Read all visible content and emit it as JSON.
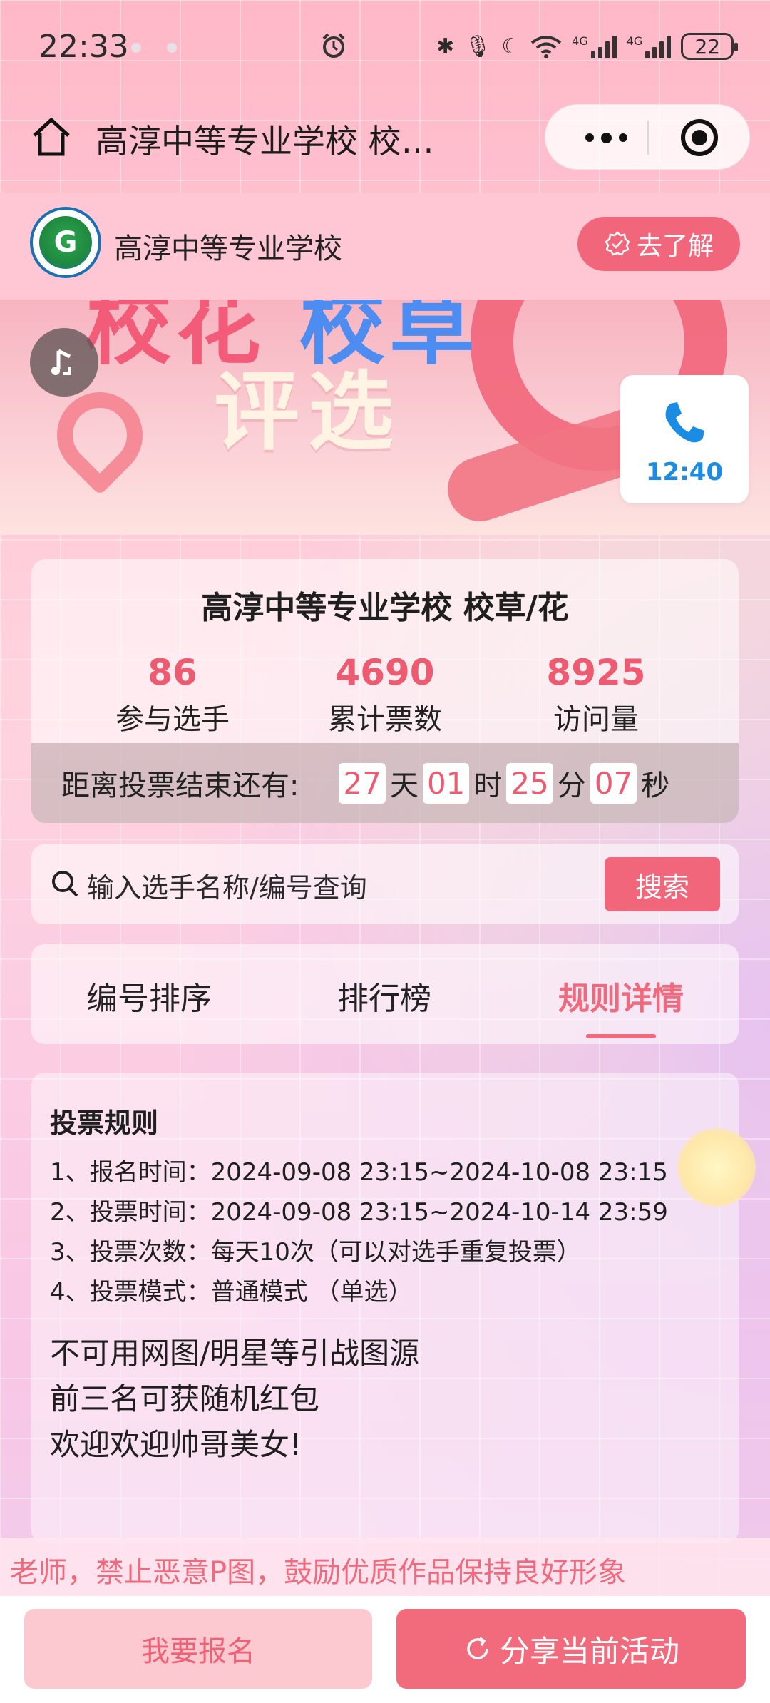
{
  "status_bar": {
    "time": "22:33",
    "battery": "22",
    "network": "4G"
  },
  "nav": {
    "title": "高淳中等专业学校 校…"
  },
  "header": {
    "school_name": "高淳中等专业学校",
    "learn_more": "去了解",
    "logo_letter": "G"
  },
  "banner": {
    "title_cut_left": "校花",
    "title_cut_right": "校草",
    "title": "评选"
  },
  "call_widget": {
    "time": "12:40"
  },
  "stats": {
    "title": "高淳中等专业学校 校草/花",
    "items": [
      {
        "value": "86",
        "label": "参与选手"
      },
      {
        "value": "4690",
        "label": "累计票数"
      },
      {
        "value": "8925",
        "label": "访问量"
      }
    ]
  },
  "countdown": {
    "label": "距离投票结束还有:",
    "days": "27",
    "days_unit": "天",
    "hours": "01",
    "hours_unit": "时",
    "minutes": "25",
    "minutes_unit": "分",
    "seconds": "07",
    "seconds_unit": "秒"
  },
  "search": {
    "placeholder": "输入选手名称/编号查询",
    "button": "搜索"
  },
  "tabs": [
    {
      "label": "编号排序"
    },
    {
      "label": "排行榜"
    },
    {
      "label": "规则详情"
    }
  ],
  "rules": {
    "heading": "投票规则",
    "lines": [
      "1、报名时间：2024-09-08 23:15~2024-10-08 23:15",
      "2、投票时间：2024-09-08 23:15~2024-10-14 23:59",
      "3、投票次数：每天10次（可以对选手重复投票）",
      "4、投票模式：普通模式 （单选）"
    ],
    "notes": [
      "不可用网图/明星等引战图源",
      "前三名可获随机红包",
      "欢迎欢迎帅哥美女!"
    ]
  },
  "marquee": {
    "text": "老师，禁止恶意P图，鼓励优质作品保持良好形象"
  },
  "bottom": {
    "signup": "我要报名",
    "share": "分享当前活动"
  },
  "colors": {
    "accent": "#f1667a",
    "call_blue": "#1b8ce3",
    "page_pink": "#ffc7d5"
  }
}
